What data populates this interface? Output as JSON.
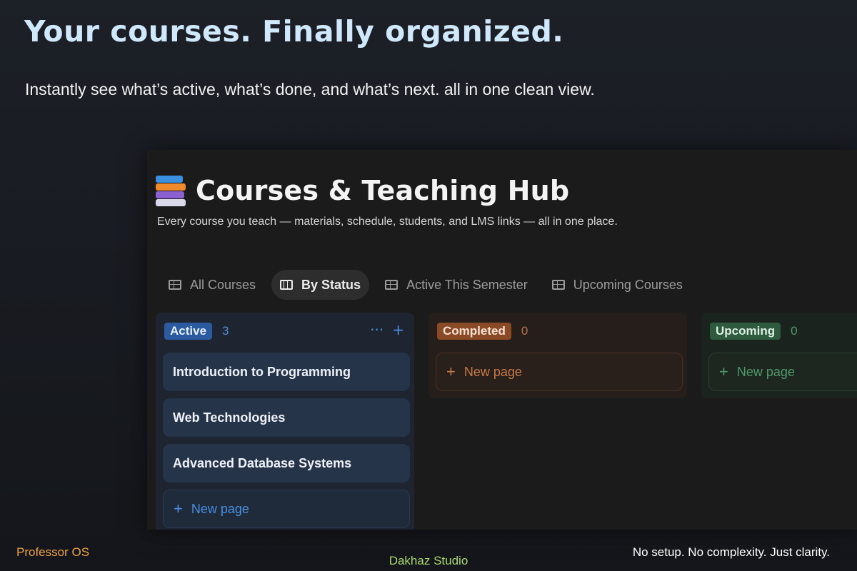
{
  "hero": {
    "headline": "Your courses. Finally organized.",
    "subheadline": "Instantly see what’s active, what’s done, and what’s next. all in one clean view."
  },
  "app": {
    "title_icon": "books-icon",
    "title": "Courses & Teaching Hub",
    "description": "Every course you teach — materials, schedule, students, and LMS links — all in one place.",
    "tabs": [
      {
        "label": "All Courses",
        "icon": "table-icon",
        "active": false
      },
      {
        "label": "By Status",
        "icon": "board-icon",
        "active": true
      },
      {
        "label": "Active This Semester",
        "icon": "table-icon",
        "active": false
      },
      {
        "label": "Upcoming Courses",
        "icon": "table-icon",
        "active": false
      }
    ],
    "columns": [
      {
        "status": "Active",
        "count": "3",
        "color": "#2b5aa0",
        "cards": [
          "Introduction to Programming",
          "Web Technologies",
          "Advanced Database Systems"
        ],
        "new_page_label": "New page",
        "more_icon": "···",
        "add_icon": "+"
      },
      {
        "status": "Completed",
        "count": "0",
        "color": "#8a4a26",
        "cards": [],
        "new_page_label": "New page"
      },
      {
        "status": "Upcoming",
        "count": "0",
        "color": "#2e5a3e",
        "cards": [],
        "new_page_label": "New page"
      }
    ]
  },
  "footer": {
    "left": "Professor OS",
    "center": "Dakhaz Studio",
    "right": "No setup. No complexity. Just clarity."
  }
}
